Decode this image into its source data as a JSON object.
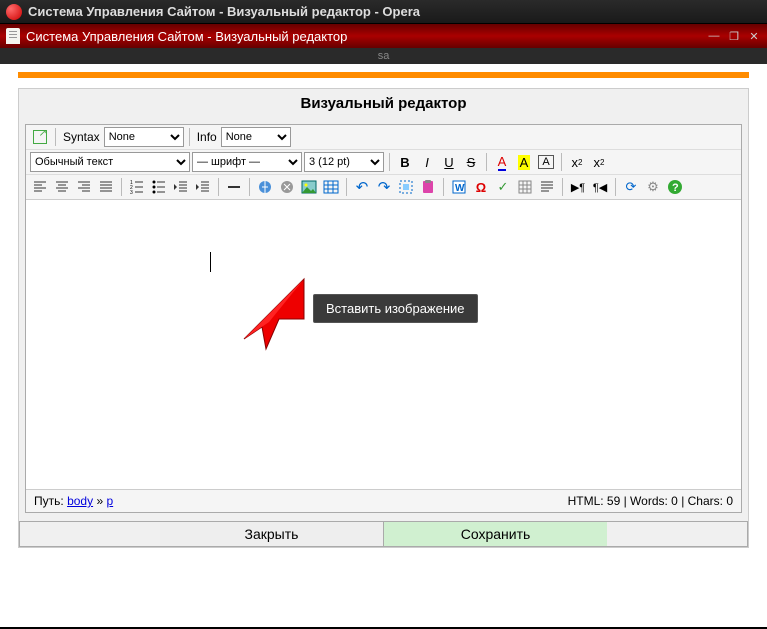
{
  "browser": {
    "title": "Система Управления Сайтом - Визуальный редактор - Opera"
  },
  "tab": {
    "title": "Система Управления Сайтом - Визуальный редактор"
  },
  "sa": "sa",
  "panel": {
    "header": "Визуальный редактор"
  },
  "row1": {
    "syntax_label": "Syntax",
    "syntax_value": "None",
    "info_label": "Info",
    "info_value": "None"
  },
  "row2": {
    "format": "Обычный текст",
    "font": "— шрифт —",
    "size": "3 (12 pt)"
  },
  "tooltip": "Вставить изображение",
  "status": {
    "path_label": "Путь:",
    "path_body": "body",
    "path_sep": "»",
    "path_p": "p",
    "stats": "HTML: 59 | Words: 0 | Chars: 0"
  },
  "buttons": {
    "close": "Закрыть",
    "save": "Сохранить"
  }
}
